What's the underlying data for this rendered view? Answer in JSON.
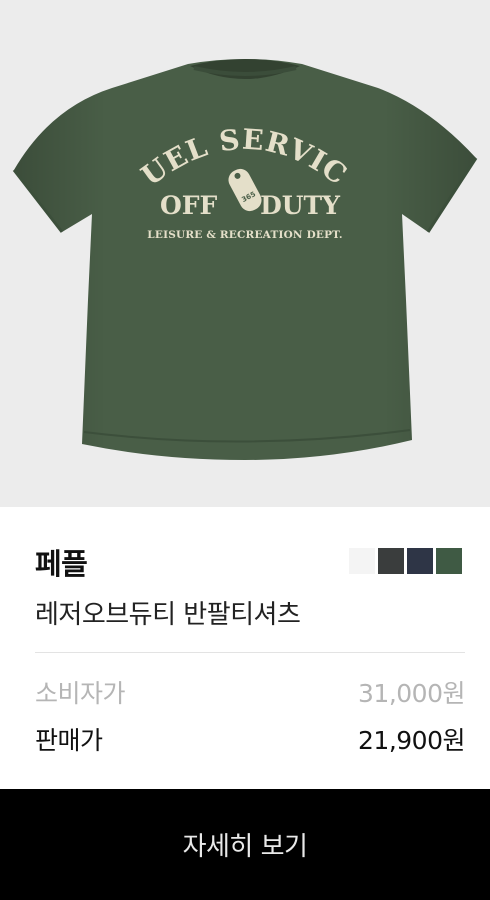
{
  "product": {
    "brand": "페플",
    "name": "레저오브듀티 반팔티셔츠",
    "colors": [
      "#f4f4f4",
      "#3a3d3d",
      "#2e3546",
      "#3f5a44"
    ],
    "shirt_color": "#495e47",
    "print": {
      "line1": "FUEL SERVICE",
      "line2_left": "OFF",
      "line2_right": "DUTY",
      "line3": "LEISURE & RECREATION DEPT.",
      "tag_number": "365"
    }
  },
  "prices": {
    "msrp_label": "소비자가",
    "msrp_value": "31,000원",
    "sale_label": "판매가",
    "sale_value": "21,900원"
  },
  "cta": {
    "label": "자세히 보기"
  }
}
